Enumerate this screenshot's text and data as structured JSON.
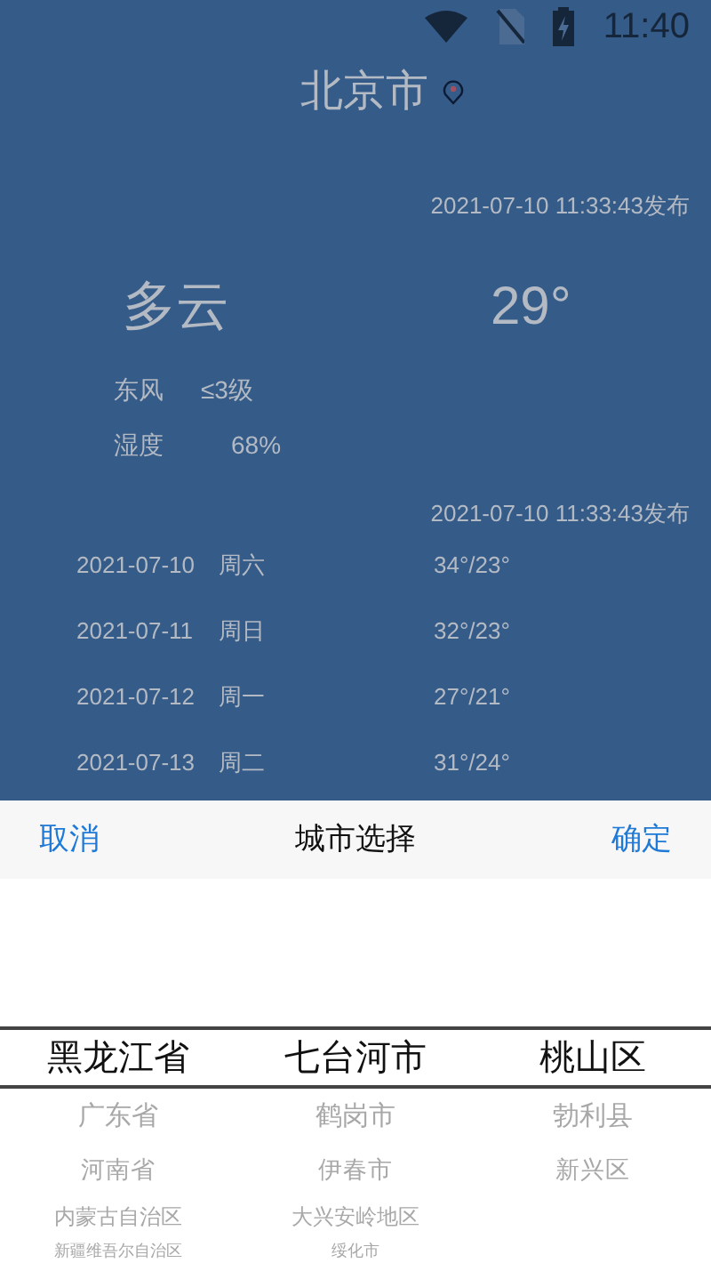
{
  "status_bar": {
    "time": "11:40"
  },
  "city": "北京市",
  "publish_time": "2021-07-10 11:33:43发布",
  "weather": "多云",
  "temperature": "29°",
  "wind": {
    "direction": "东风",
    "level": "≤3级"
  },
  "humidity": {
    "label": "湿度",
    "value": "68%"
  },
  "forecast_publish_time": "2021-07-10 11:33:43发布",
  "forecast": [
    {
      "date": "2021-07-10",
      "weekday": "周六",
      "temps": "34°/23°"
    },
    {
      "date": "2021-07-11",
      "weekday": "周日",
      "temps": "32°/23°"
    },
    {
      "date": "2021-07-12",
      "weekday": "周一",
      "temps": "27°/21°"
    },
    {
      "date": "2021-07-13",
      "weekday": "周二",
      "temps": "31°/24°"
    }
  ],
  "picker": {
    "cancel": "取消",
    "title": "城市选择",
    "confirm": "确定",
    "columns": [
      [
        {
          "label": "黑龙江省",
          "selected": true
        },
        {
          "label": "广东省",
          "selected": false
        },
        {
          "label": "河南省",
          "selected": false
        },
        {
          "label": "内蒙古自治区",
          "selected": false
        },
        {
          "label": "新疆维吾尔自治区",
          "selected": false
        }
      ],
      [
        {
          "label": "七台河市",
          "selected": true
        },
        {
          "label": "鹤岗市",
          "selected": false
        },
        {
          "label": "伊春市",
          "selected": false
        },
        {
          "label": "大兴安岭地区",
          "selected": false
        },
        {
          "label": "绥化市",
          "selected": false
        }
      ],
      [
        {
          "label": "桃山区",
          "selected": true
        },
        {
          "label": "勃利县",
          "selected": false
        },
        {
          "label": "新兴区",
          "selected": false
        }
      ]
    ]
  }
}
